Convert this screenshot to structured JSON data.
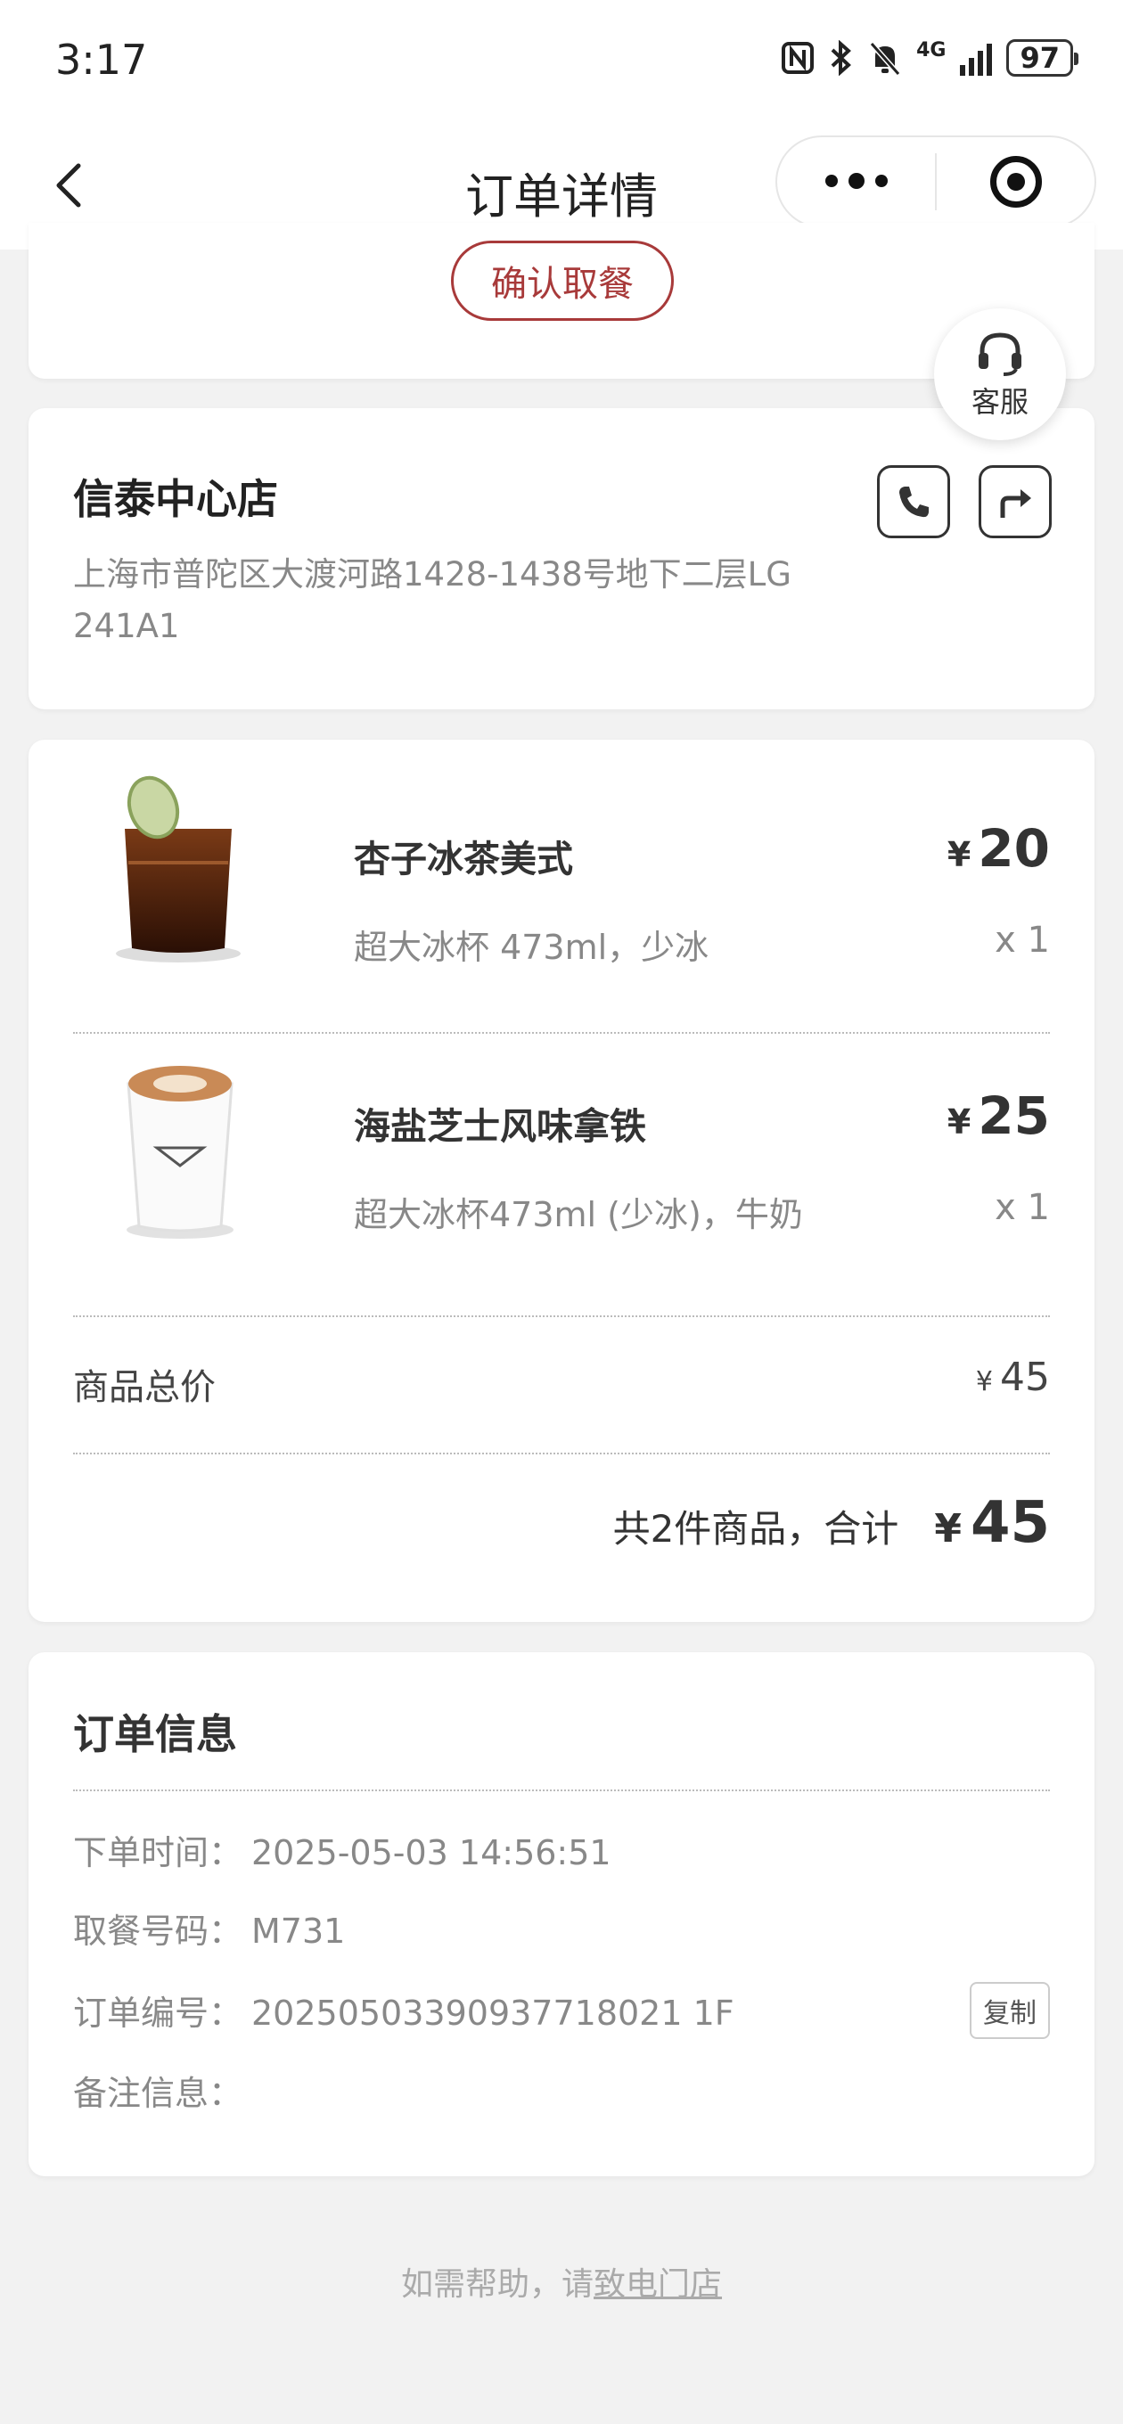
{
  "status_bar": {
    "time": "3:17",
    "network": "4G",
    "battery": "97"
  },
  "nav": {
    "title": "订单详情"
  },
  "actions": {
    "confirm_pickup": "确认取餐",
    "customer_service": "客服"
  },
  "store": {
    "name": "信泰中心店",
    "address": "上海市普陀区大渡河路1428-1438号地下二层LG 241A1"
  },
  "items": [
    {
      "name": "杏子冰茶美式",
      "spec": "超大冰杯 473ml，少冰",
      "currency": "¥",
      "price": "20",
      "qty": "x 1"
    },
    {
      "name": "海盐芝士风味拿铁",
      "spec": "超大冰杯473ml (少冰)，牛奶",
      "currency": "¥",
      "price": "25",
      "qty": "x 1"
    }
  ],
  "summary": {
    "subtotal_label": "商品总价",
    "subtotal_currency": "¥",
    "subtotal": "45",
    "total_text": "共2件商品，合计",
    "total_currency": "¥",
    "total": "45"
  },
  "order_info": {
    "title": "订单信息",
    "rows": [
      {
        "label": "下单时间：",
        "value": "2025-05-03 14:56:51"
      },
      {
        "label": "取餐号码：",
        "value": "M731"
      },
      {
        "label": "订单编号：",
        "value": "20250503390937718021 1F"
      },
      {
        "label": "备注信息：",
        "value": ""
      }
    ],
    "copy_label": "复制"
  },
  "footer": {
    "help_prefix": "如需帮助，请",
    "help_link": "致电门店"
  },
  "colors": {
    "accent": "#a83a3a",
    "background": "#f2f2f2"
  }
}
